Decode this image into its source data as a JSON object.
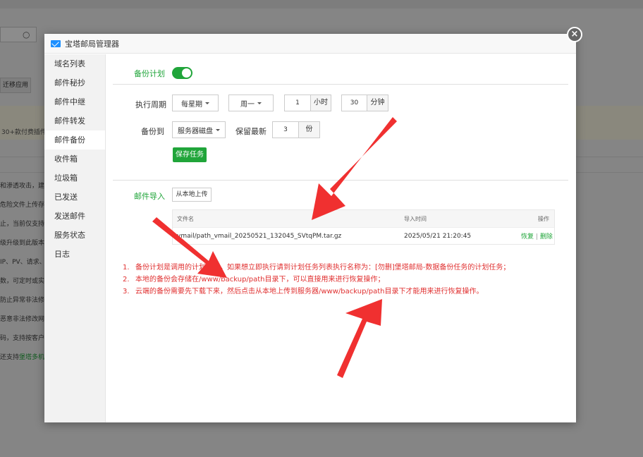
{
  "background": {
    "search_icon": "○",
    "button_label": "迁移应用",
    "banner_text": "30+款付费插件",
    "lines": [
      "和渗透攻击，建议",
      "危险文件上传存备",
      "止，当前仅支持Ap",
      "级升级到此版本，",
      "IP、PV、请求、流",
      "数，可定时或实时",
      "防止异常非法修改",
      "恶意非法修改网页",
      "码，支持按客户日",
      "还支持"
    ],
    "link_text": "堡塔多机备"
  },
  "dialog": {
    "title": "宝塔邮局管理器",
    "close_icon": "×"
  },
  "sidebar": {
    "items": [
      {
        "label": "域名列表"
      },
      {
        "label": "邮件秘抄"
      },
      {
        "label": "邮件中继"
      },
      {
        "label": "邮件转发"
      },
      {
        "label": "邮件备份"
      },
      {
        "label": "收件箱"
      },
      {
        "label": "垃圾箱"
      },
      {
        "label": "已发送"
      },
      {
        "label": "发送邮件"
      },
      {
        "label": "服务状态"
      },
      {
        "label": "日志"
      }
    ],
    "active_index": 4
  },
  "backup_plan": {
    "label": "备份计划",
    "enabled": true,
    "period_label": "执行周期",
    "period_select": "每星期",
    "weekday_select": "周一",
    "hour_value": "1",
    "hour_unit": "小时",
    "minute_value": "30",
    "minute_unit": "分钟",
    "backup_to_label": "备份到",
    "backup_to_select": "服务器磁盘",
    "keep_label": "保留最新",
    "keep_value": "3",
    "keep_unit": "份",
    "save_button": "保存任务"
  },
  "mail_import": {
    "label": "邮件导入",
    "upload_button": "从本地上传",
    "table": {
      "headers": {
        "filename": "文件名",
        "import_time": "导入时间",
        "operation": "操作"
      },
      "rows": [
        {
          "filename": "vmail/path_vmail_20250521_132045_SVtqPM.tar.gz",
          "import_time": "2025/05/21 21:20:45",
          "restore": "恢复",
          "sep": "|",
          "delete": "删除"
        }
      ]
    }
  },
  "tips": [
    {
      "num": "1.",
      "text": "备份计划是调用的计划任务，如果想立即执行请到计划任务列表执行名称为：[勿删]堡塔邮局-数据备份任务的计划任务；"
    },
    {
      "num": "2.",
      "text": "本地的备份会存储在/www/backup/path目录下，可以直接用来进行恢复操作；"
    },
    {
      "num": "3.",
      "text": "云端的备份需要先下载下来，然后点击从本地上传到服务器/www/backup/path目录下才能用来进行恢复操作。"
    }
  ],
  "colors": {
    "accent": "#20a53a",
    "warning_text": "#e03030",
    "arrow": "#f03030"
  }
}
